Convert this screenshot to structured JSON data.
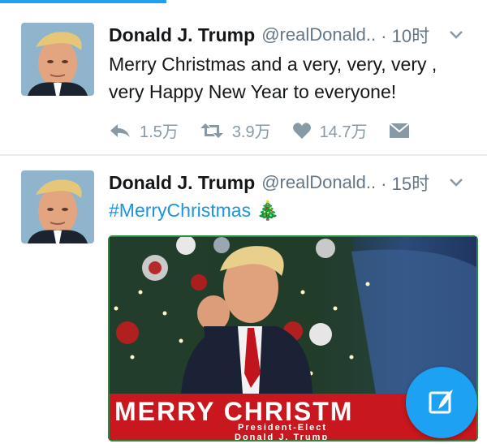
{
  "ui": {
    "accent": "#1da1f2",
    "text_secondary": "#657786"
  },
  "tweets": [
    {
      "author_name": "Donald J. Trump",
      "handle": "@realDonald..",
      "time": "· 10时",
      "text": "Merry Christmas and a very, very, very , very Happy New Year to everyone!",
      "actions": {
        "reply_count": "1.5万",
        "retweet_count": "3.9万",
        "like_count": "14.7万"
      }
    },
    {
      "author_name": "Donald J. Trump",
      "handle": "@realDonald..",
      "time": "· 15时",
      "text": "#MerryChristmas 🎄",
      "media": {
        "banner_title": "MERRY CHRISTM",
        "banner_line1": "President-Elect",
        "banner_line2": "Donald J. Trump"
      }
    }
  ],
  "fab": {
    "icon": "compose-icon"
  }
}
